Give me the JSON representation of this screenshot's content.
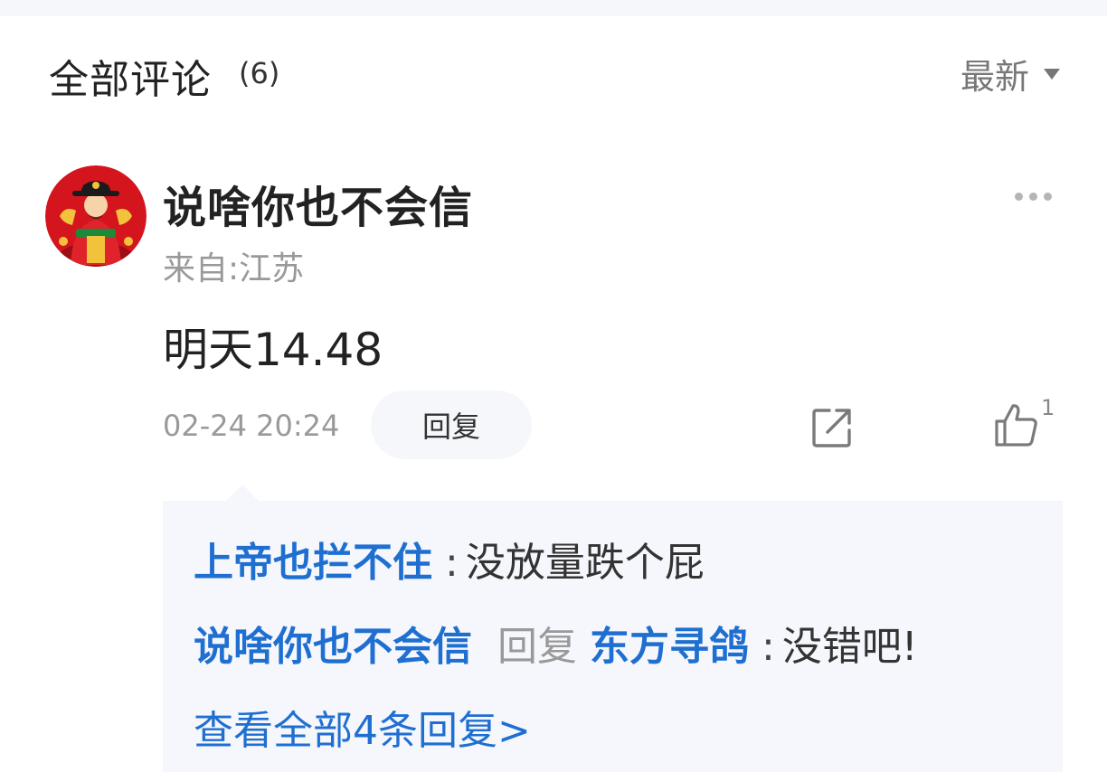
{
  "header": {
    "title": "全部评论",
    "count": "(6)",
    "sort_label": "最新"
  },
  "comment": {
    "author": "说啥你也不会信",
    "location": "来自:江苏",
    "content": "明天14.48",
    "time": "02-24 20:24",
    "reply_label": "回复",
    "like_count": "1",
    "icons": {
      "avatar": "god-of-wealth-avatar",
      "more": "more-dots-icon",
      "share": "share-icon",
      "like": "thumbs-up-icon"
    }
  },
  "replies": {
    "items": [
      {
        "author": "上帝也拦不住",
        "text": "没放量跌个屁"
      },
      {
        "author": "说啥你也不会信",
        "reply_word": "回复",
        "target": "东方寻鸽",
        "text": "没错吧!"
      }
    ],
    "view_all": "查看全部4条回复>"
  },
  "colors": {
    "link_blue": "#1f6fd1",
    "muted_gray": "#999999",
    "reply_bg": "#f5f7fc"
  }
}
